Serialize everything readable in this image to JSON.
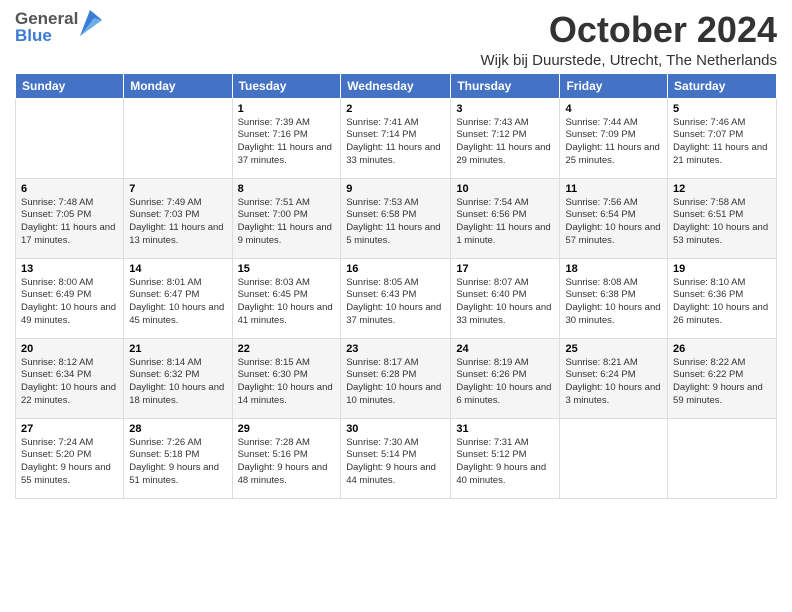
{
  "header": {
    "logo_general": "General",
    "logo_blue": "Blue",
    "month_title": "October 2024",
    "location": "Wijk bij Duurstede, Utrecht, The Netherlands"
  },
  "weekdays": [
    "Sunday",
    "Monday",
    "Tuesday",
    "Wednesday",
    "Thursday",
    "Friday",
    "Saturday"
  ],
  "weeks": [
    [
      {
        "day": "",
        "sunrise": "",
        "sunset": "",
        "daylight": ""
      },
      {
        "day": "",
        "sunrise": "",
        "sunset": "",
        "daylight": ""
      },
      {
        "day": "1",
        "sunrise": "Sunrise: 7:39 AM",
        "sunset": "Sunset: 7:16 PM",
        "daylight": "Daylight: 11 hours and 37 minutes."
      },
      {
        "day": "2",
        "sunrise": "Sunrise: 7:41 AM",
        "sunset": "Sunset: 7:14 PM",
        "daylight": "Daylight: 11 hours and 33 minutes."
      },
      {
        "day": "3",
        "sunrise": "Sunrise: 7:43 AM",
        "sunset": "Sunset: 7:12 PM",
        "daylight": "Daylight: 11 hours and 29 minutes."
      },
      {
        "day": "4",
        "sunrise": "Sunrise: 7:44 AM",
        "sunset": "Sunset: 7:09 PM",
        "daylight": "Daylight: 11 hours and 25 minutes."
      },
      {
        "day": "5",
        "sunrise": "Sunrise: 7:46 AM",
        "sunset": "Sunset: 7:07 PM",
        "daylight": "Daylight: 11 hours and 21 minutes."
      }
    ],
    [
      {
        "day": "6",
        "sunrise": "Sunrise: 7:48 AM",
        "sunset": "Sunset: 7:05 PM",
        "daylight": "Daylight: 11 hours and 17 minutes."
      },
      {
        "day": "7",
        "sunrise": "Sunrise: 7:49 AM",
        "sunset": "Sunset: 7:03 PM",
        "daylight": "Daylight: 11 hours and 13 minutes."
      },
      {
        "day": "8",
        "sunrise": "Sunrise: 7:51 AM",
        "sunset": "Sunset: 7:00 PM",
        "daylight": "Daylight: 11 hours and 9 minutes."
      },
      {
        "day": "9",
        "sunrise": "Sunrise: 7:53 AM",
        "sunset": "Sunset: 6:58 PM",
        "daylight": "Daylight: 11 hours and 5 minutes."
      },
      {
        "day": "10",
        "sunrise": "Sunrise: 7:54 AM",
        "sunset": "Sunset: 6:56 PM",
        "daylight": "Daylight: 11 hours and 1 minute."
      },
      {
        "day": "11",
        "sunrise": "Sunrise: 7:56 AM",
        "sunset": "Sunset: 6:54 PM",
        "daylight": "Daylight: 10 hours and 57 minutes."
      },
      {
        "day": "12",
        "sunrise": "Sunrise: 7:58 AM",
        "sunset": "Sunset: 6:51 PM",
        "daylight": "Daylight: 10 hours and 53 minutes."
      }
    ],
    [
      {
        "day": "13",
        "sunrise": "Sunrise: 8:00 AM",
        "sunset": "Sunset: 6:49 PM",
        "daylight": "Daylight: 10 hours and 49 minutes."
      },
      {
        "day": "14",
        "sunrise": "Sunrise: 8:01 AM",
        "sunset": "Sunset: 6:47 PM",
        "daylight": "Daylight: 10 hours and 45 minutes."
      },
      {
        "day": "15",
        "sunrise": "Sunrise: 8:03 AM",
        "sunset": "Sunset: 6:45 PM",
        "daylight": "Daylight: 10 hours and 41 minutes."
      },
      {
        "day": "16",
        "sunrise": "Sunrise: 8:05 AM",
        "sunset": "Sunset: 6:43 PM",
        "daylight": "Daylight: 10 hours and 37 minutes."
      },
      {
        "day": "17",
        "sunrise": "Sunrise: 8:07 AM",
        "sunset": "Sunset: 6:40 PM",
        "daylight": "Daylight: 10 hours and 33 minutes."
      },
      {
        "day": "18",
        "sunrise": "Sunrise: 8:08 AM",
        "sunset": "Sunset: 6:38 PM",
        "daylight": "Daylight: 10 hours and 30 minutes."
      },
      {
        "day": "19",
        "sunrise": "Sunrise: 8:10 AM",
        "sunset": "Sunset: 6:36 PM",
        "daylight": "Daylight: 10 hours and 26 minutes."
      }
    ],
    [
      {
        "day": "20",
        "sunrise": "Sunrise: 8:12 AM",
        "sunset": "Sunset: 6:34 PM",
        "daylight": "Daylight: 10 hours and 22 minutes."
      },
      {
        "day": "21",
        "sunrise": "Sunrise: 8:14 AM",
        "sunset": "Sunset: 6:32 PM",
        "daylight": "Daylight: 10 hours and 18 minutes."
      },
      {
        "day": "22",
        "sunrise": "Sunrise: 8:15 AM",
        "sunset": "Sunset: 6:30 PM",
        "daylight": "Daylight: 10 hours and 14 minutes."
      },
      {
        "day": "23",
        "sunrise": "Sunrise: 8:17 AM",
        "sunset": "Sunset: 6:28 PM",
        "daylight": "Daylight: 10 hours and 10 minutes."
      },
      {
        "day": "24",
        "sunrise": "Sunrise: 8:19 AM",
        "sunset": "Sunset: 6:26 PM",
        "daylight": "Daylight: 10 hours and 6 minutes."
      },
      {
        "day": "25",
        "sunrise": "Sunrise: 8:21 AM",
        "sunset": "Sunset: 6:24 PM",
        "daylight": "Daylight: 10 hours and 3 minutes."
      },
      {
        "day": "26",
        "sunrise": "Sunrise: 8:22 AM",
        "sunset": "Sunset: 6:22 PM",
        "daylight": "Daylight: 9 hours and 59 minutes."
      }
    ],
    [
      {
        "day": "27",
        "sunrise": "Sunrise: 7:24 AM",
        "sunset": "Sunset: 5:20 PM",
        "daylight": "Daylight: 9 hours and 55 minutes."
      },
      {
        "day": "28",
        "sunrise": "Sunrise: 7:26 AM",
        "sunset": "Sunset: 5:18 PM",
        "daylight": "Daylight: 9 hours and 51 minutes."
      },
      {
        "day": "29",
        "sunrise": "Sunrise: 7:28 AM",
        "sunset": "Sunset: 5:16 PM",
        "daylight": "Daylight: 9 hours and 48 minutes."
      },
      {
        "day": "30",
        "sunrise": "Sunrise: 7:30 AM",
        "sunset": "Sunset: 5:14 PM",
        "daylight": "Daylight: 9 hours and 44 minutes."
      },
      {
        "day": "31",
        "sunrise": "Sunrise: 7:31 AM",
        "sunset": "Sunset: 5:12 PM",
        "daylight": "Daylight: 9 hours and 40 minutes."
      },
      {
        "day": "",
        "sunrise": "",
        "sunset": "",
        "daylight": ""
      },
      {
        "day": "",
        "sunrise": "",
        "sunset": "",
        "daylight": ""
      }
    ]
  ]
}
